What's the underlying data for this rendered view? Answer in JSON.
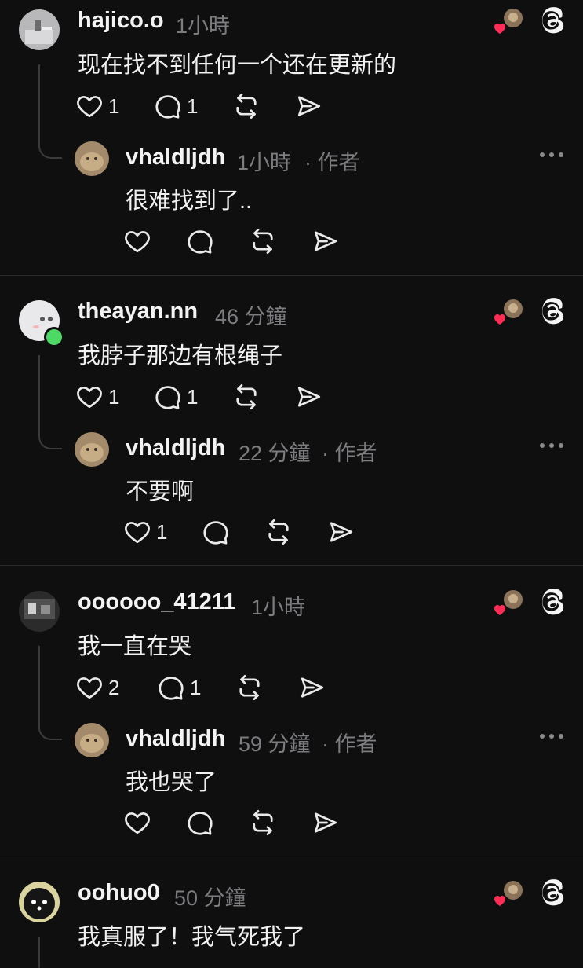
{
  "threads": [
    {
      "user": "hajico.o",
      "time": "1小時",
      "text": "现在找不到任何一个还在更新的",
      "likes": "1",
      "replies": "1",
      "reply": {
        "user": "vhaldljdh",
        "time": "1小時",
        "author_tag": "· 作者",
        "text": "很难找到了..",
        "likes": ""
      }
    },
    {
      "user": "theayan.nn",
      "time": "46 分鐘",
      "text": "我脖子那边有根绳子",
      "likes": "1",
      "replies": "1",
      "reply": {
        "user": "vhaldljdh",
        "time": "22 分鐘",
        "author_tag": "· 作者",
        "text": "不要啊",
        "likes": "1"
      }
    },
    {
      "user": "oooooo_41211",
      "time": "1小時",
      "text": "我一直在哭",
      "likes": "2",
      "replies": "1",
      "reply": {
        "user": "vhaldljdh",
        "time": "59 分鐘",
        "author_tag": "· 作者",
        "text": "我也哭了",
        "likes": ""
      }
    },
    {
      "user": "oohuo0",
      "time": "50 分鐘",
      "text": "我真服了！我气死我了"
    }
  ],
  "icons": {
    "like": "heart-outline-icon",
    "comment": "comment-bubble-icon",
    "repost": "repost-icon",
    "share": "send-icon",
    "threads": "threads-logo-icon",
    "liked_by_author": "author-liked-heart-icon",
    "more": "more-options-icon"
  },
  "colors": {
    "background": "#0f0f10",
    "heart_red": "#ff2d55",
    "online_green": "#4cd964",
    "meta_gray": "#7d7d80"
  }
}
